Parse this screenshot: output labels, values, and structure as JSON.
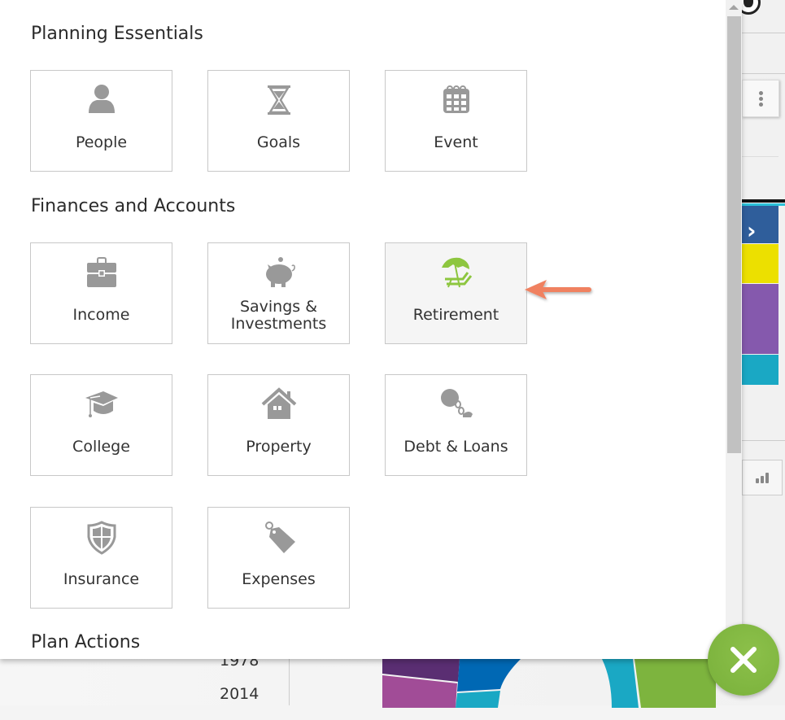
{
  "panel": {
    "sections": [
      {
        "title": "Planning Essentials",
        "tiles": [
          {
            "label": "People",
            "icon": "person-icon"
          },
          {
            "label": "Goals",
            "icon": "hourglass-icon"
          },
          {
            "label": "Event",
            "icon": "calendar-icon"
          }
        ]
      },
      {
        "title": "Finances and Accounts",
        "tiles": [
          {
            "label": "Income",
            "icon": "briefcase-icon"
          },
          {
            "label": "Savings &",
            "label2": "Investments",
            "icon": "piggy-bank-icon"
          },
          {
            "label": "Retirement",
            "icon": "beach-chair-umbrella-icon",
            "selected": true
          },
          {
            "label": "College",
            "icon": "graduation-cap-icon"
          },
          {
            "label": "Property",
            "icon": "house-icon"
          },
          {
            "label": "Debt & Loans",
            "icon": "ball-and-chain-icon"
          },
          {
            "label": "Insurance",
            "icon": "shield-icon"
          },
          {
            "label": "Expenses",
            "icon": "price-tag-icon"
          }
        ]
      },
      {
        "title": "Plan Actions",
        "tiles": []
      }
    ]
  },
  "colors": {
    "icon_gray": "#999999",
    "retirement_green": "#8dc63f",
    "annotation_arrow": "#f08160",
    "fab_green": "#7db43e",
    "tile_border": "#c8c8c8"
  },
  "background": {
    "years": [
      "1978",
      "2014"
    ],
    "chart_colors": [
      "#2f5e9b",
      "#ece000",
      "#8559ad",
      "#1aa8c4",
      "#7db43e",
      "#a14c97",
      "#5a2e72",
      "#0068b4"
    ]
  },
  "close_button": {
    "icon": "close-icon"
  }
}
